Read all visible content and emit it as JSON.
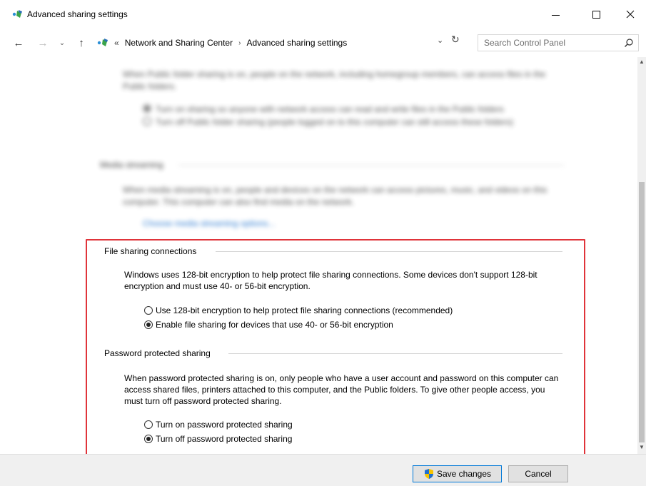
{
  "window": {
    "title": "Advanced sharing settings",
    "controls": {
      "minimize": "—",
      "maximize": "☐",
      "close": "✕"
    }
  },
  "nav": {
    "back_icon": "←",
    "forward_icon": "→",
    "recent_icon": "⌄",
    "up_icon": "↑",
    "overflow": "«",
    "breadcrumbs": [
      "Network and Sharing Center",
      "Advanced sharing settings"
    ],
    "crumb_separator": "›",
    "dropdown_icon": "⌄",
    "refresh_icon": "↻",
    "search_placeholder": "Search Control Panel"
  },
  "blurred": {
    "public_desc": "When Public folder sharing is on, people on the network, including homegroup members, can access files in the Public folders.",
    "public_opt1": "Turn on sharing so anyone with network access can read and write files in the Public folders",
    "public_opt2": "Turn off Public folder sharing (people logged on to this computer can still access these folders)",
    "media_title": "Media streaming",
    "media_desc": "When media streaming is on, people and devices on the network can access pictures, music, and videos on this computer. This computer can also find media on the network.",
    "media_link": "Choose media streaming options..."
  },
  "file_sharing": {
    "title": "File sharing connections",
    "description": "Windows uses 128-bit encryption to help protect file sharing connections. Some devices don't support 128-bit encryption and must use 40- or 56-bit encryption.",
    "options": [
      {
        "label": "Use 128-bit encryption to help protect file sharing connections (recommended)",
        "checked": false
      },
      {
        "label": "Enable file sharing for devices that use 40- or 56-bit encryption",
        "checked": true
      }
    ]
  },
  "password_sharing": {
    "title": "Password protected sharing",
    "description": "When password protected sharing is on, only people who have a user account and password on this computer can access shared files, printers attached to this computer, and the Public folders. To give other people access, you must turn off password protected sharing.",
    "options": [
      {
        "label": "Turn on password protected sharing",
        "checked": false
      },
      {
        "label": "Turn off password protected sharing",
        "checked": true
      }
    ]
  },
  "footer": {
    "save_label": "Save changes",
    "cancel_label": "Cancel"
  },
  "colors": {
    "highlight": "#e0343a",
    "link": "#0a63c9",
    "save_border": "#0078d7"
  }
}
